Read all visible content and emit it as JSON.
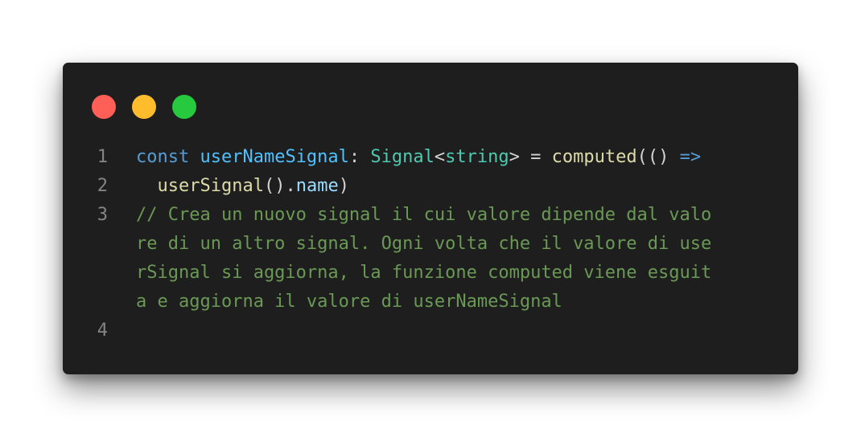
{
  "window": {
    "controls": [
      {
        "name": "close",
        "color": "#ff5f56"
      },
      {
        "name": "minimize",
        "color": "#ffbd2e"
      },
      {
        "name": "maximize",
        "color": "#27c93f"
      }
    ]
  },
  "code": {
    "lines": [
      {
        "number": "1",
        "tokens": {
          "kw_const": "const",
          "sp1": " ",
          "var_name": "userNameSignal",
          "colon": ": ",
          "type_signal": "Signal",
          "lt": "<",
          "type_string": "string",
          "gt_eq": "> = ",
          "fn_computed": "computed",
          "parens": "(() ",
          "arrow": "=>"
        }
      },
      {
        "number": "2",
        "tokens": {
          "indent": "  ",
          "fn_usersignal": "userSignal",
          "call_dot": "().",
          "prop_name": "name",
          "close": ")"
        }
      },
      {
        "number": "3",
        "comment_lines": [
          "// Crea un nuovo signal il cui valore dipende dal valo",
          "re di un altro signal. Ogni volta che il valore di use",
          "rSignal si aggiorna, la funzione computed viene esguit",
          "a e aggiorna il valore di userNameSignal"
        ]
      },
      {
        "number": "4",
        "text": ""
      }
    ]
  }
}
